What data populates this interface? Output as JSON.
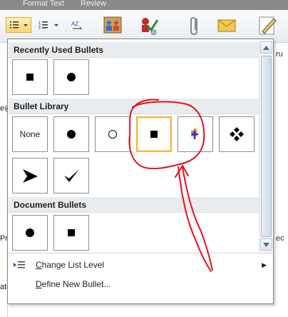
{
  "ribbon": {
    "tabs": [
      "Format Text",
      "Review"
    ],
    "list_button_icon": "bulleted-list-icon",
    "numbering_button_icon": "numbered-list-icon",
    "icons": [
      "sort-icon",
      "address-book-icon",
      "check-names-icon",
      "attach-file-icon",
      "attach-item-icon",
      "signature-icon"
    ]
  },
  "doc_fragments": {
    "left": [
      "e@",
      "Pr",
      "ate"
    ],
    "right": [
      "ru",
      "ec"
    ]
  },
  "gallery": {
    "recently_used": {
      "title": "Recently Used Bullets",
      "items": [
        {
          "name": "bullet-square",
          "glyph": "square"
        },
        {
          "name": "bullet-dot",
          "glyph": "dot"
        }
      ]
    },
    "library": {
      "title": "Bullet Library",
      "items": [
        {
          "name": "bullet-none",
          "glyph": "none",
          "label": "None"
        },
        {
          "name": "bullet-dot",
          "glyph": "dot"
        },
        {
          "name": "bullet-ring",
          "glyph": "ring"
        },
        {
          "name": "bullet-square",
          "glyph": "square",
          "selected": true
        },
        {
          "name": "bullet-arrow-tip",
          "glyph": "arrowtip"
        },
        {
          "name": "bullet-diamond-cluster",
          "glyph": "diamonds"
        },
        {
          "name": "bullet-arrowhead",
          "glyph": "arrowhead"
        },
        {
          "name": "bullet-checkmark",
          "glyph": "check"
        }
      ]
    },
    "document": {
      "title": "Document Bullets",
      "items": [
        {
          "name": "bullet-dot",
          "glyph": "dot"
        },
        {
          "name": "bullet-square",
          "glyph": "square"
        }
      ]
    }
  },
  "menu": {
    "change_list_level": {
      "label": "Change List Level",
      "icon": "indent-level-icon",
      "has_submenu": true
    },
    "define_new_bullet": {
      "label": "Define New Bullet...",
      "icon": ""
    }
  },
  "annotation": {
    "color": "#e8101c",
    "kind": "hand-drawn circle and arrow"
  },
  "colors": {
    "selected_border": "#f0b54a",
    "section_header_bg": "#e9ecef",
    "ribbon_active": "#ffd56a"
  }
}
